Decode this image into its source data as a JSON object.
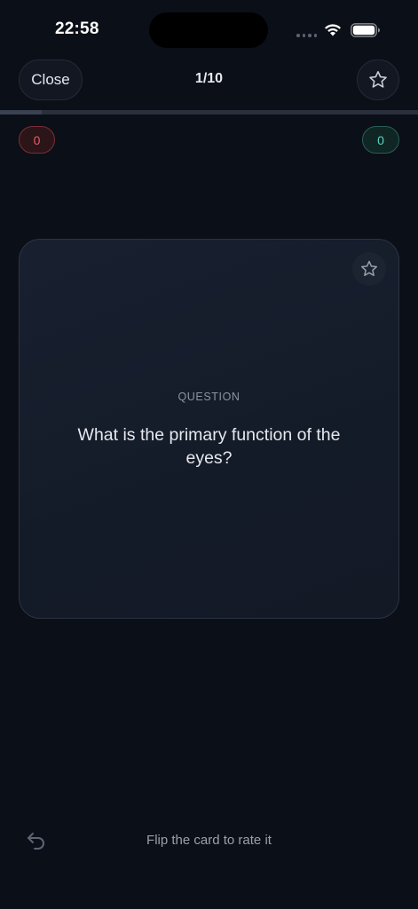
{
  "status_bar": {
    "time": "22:58"
  },
  "header": {
    "close_label": "Close",
    "progress_label": "1/10",
    "progress_fraction": 0.1,
    "star_icon": "star-outline-icon"
  },
  "counters": {
    "wrong": "0",
    "right": "0"
  },
  "card": {
    "label": "QUESTION",
    "question": "What is the primary function of the eyes?",
    "star_icon": "star-outline-icon"
  },
  "footer": {
    "undo_icon": "undo-arrow-icon",
    "hint": "Flip the card to rate it"
  },
  "colors": {
    "background": "#0b0f17",
    "wrong_accent": "#f05b63",
    "right_accent": "#5ed3c1"
  }
}
